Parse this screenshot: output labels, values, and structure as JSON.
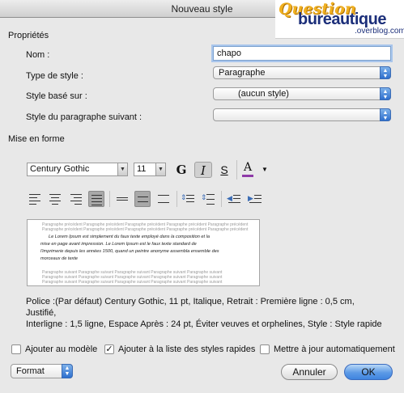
{
  "window": {
    "title": "Nouveau style"
  },
  "logo": {
    "question": "Question",
    "brand": "bureautique",
    "domain": ".overblog.com"
  },
  "proprietes": {
    "heading": "Propriétés",
    "nom_label": "Nom :",
    "nom_value": "chapo",
    "type_label": "Type de style :",
    "type_value": "Paragraphe",
    "base_label": "Style basé sur :",
    "base_value": "(aucun style)",
    "suivant_label": "Style du paragraphe suivant :",
    "suivant_value": ""
  },
  "mise_en_forme": {
    "heading": "Mise en forme",
    "font": "Century Gothic",
    "size": "11",
    "bold": "G",
    "italic": "I",
    "underline": "S",
    "color_letter": "A",
    "font_color": "#8e3aa8",
    "icons": [
      "bold-icon",
      "italic-icon",
      "underline-icon",
      "font-color-icon",
      "align-left-icon",
      "align-center-icon",
      "align-right-icon",
      "justify-icon",
      "single-spacing-icon",
      "one-half-spacing-icon",
      "double-spacing-icon",
      "space-before-decrease-icon",
      "space-before-increase-icon",
      "decrease-indent-icon",
      "increase-indent-icon"
    ]
  },
  "preview": {
    "paragraph_filler": "Paragraphe précédent Paragraphe précédent Paragraphe précédent Paragraphe précédent Paragraphe précédent",
    "line1": "Le Lorem Ipsum est simplement du faux texte employé dans la composition et la",
    "line2": "mise en page avant impression. Le Lorem Ipsum est le faux texte standard de",
    "line3": "l'imprimerie depuis les années 1500, quand un peintre anonyme assembla ensemble des",
    "line4": "morceaux de texte",
    "following_filler": "Paragraphe suivant Paragraphe suivant Paragraphe suivant Paragraphe suivant Paragraphe suivant"
  },
  "description": {
    "line1": "Police :(Par défaut) Century Gothic, 11 pt, Italique, Retrait : Première ligne :  0,5 cm, Justifié,",
    "line2": "Interligne :  1,5 ligne, Espace Après :  24 pt, Éviter veuves et orphelines, Style : Style rapide"
  },
  "options": {
    "add_template": "Ajouter au modèle",
    "add_template_checked": false,
    "add_quick": "Ajouter à la liste des styles rapides",
    "add_quick_checked": true,
    "auto_update": "Mettre à jour automatiquement",
    "auto_update_checked": false
  },
  "footer": {
    "format": "Format",
    "cancel": "Annuler",
    "ok": "OK"
  }
}
